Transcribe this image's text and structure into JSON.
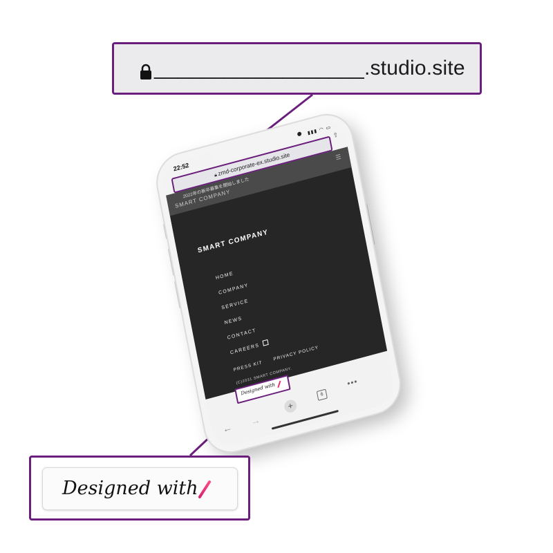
{
  "url_callout": {
    "url_placeholder": "__________________",
    "url_suffix": ".studio.site"
  },
  "phone": {
    "status_bar": {
      "time": "22:52",
      "icons": "▮▮▮ ◠ ▭"
    },
    "address_bar": {
      "url": "zmd-corporate-ex.studio.site"
    },
    "site": {
      "notice": "2022年の新卒募集を開始しました",
      "header_brand": "SMART COMPANY",
      "brand": "SMART COMPANY",
      "menu": [
        {
          "label": "HOME"
        },
        {
          "label": "COMPANY"
        },
        {
          "label": "SERVICE"
        },
        {
          "label": "NEWS"
        },
        {
          "label": "CONTACT"
        },
        {
          "label": "CAREERS"
        }
      ],
      "footer_links": [
        "PRESS KIT",
        "PRIVACY POLICY"
      ],
      "copyright": "(C)2031 SMART COMPANY."
    },
    "badge_text": "Designed with",
    "toolbar": {
      "back": "←",
      "forward": "→",
      "new_tab": "+",
      "tab_count": "6",
      "more": "•••"
    }
  },
  "badge_callout": {
    "text": "Designed with"
  },
  "colors": {
    "callout_border": "#6b1f7c",
    "site_background": "#262626",
    "badge_accent": "#e0306f"
  }
}
